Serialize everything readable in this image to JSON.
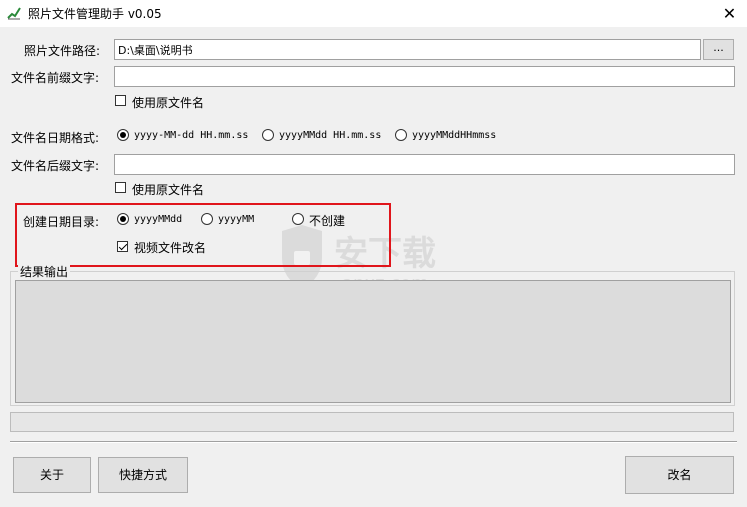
{
  "window": {
    "title": "照片文件管理助手 v0.05",
    "close_glyph": "✕"
  },
  "form": {
    "photo_path_label": "照片文件路径:",
    "photo_path_value": "D:\\桌面\\说明书",
    "browse_label": "...",
    "prefix_label": "文件名前缀文字:",
    "prefix_value": "",
    "use_original_name_1": "使用原文件名",
    "date_format_label": "文件名日期格式:",
    "date_formats": [
      "yyyy-MM-dd HH.mm.ss",
      "yyyyMMdd HH.mm.ss",
      "yyyyMMddHHmmss"
    ],
    "date_format_selected": 0,
    "suffix_label": "文件名后缀文字:",
    "suffix_value": "",
    "use_original_name_2": "使用原文件名",
    "create_dir_label": "创建日期目录:",
    "create_dir_options": [
      "yyyyMMdd",
      "yyyyMM",
      "不创建"
    ],
    "create_dir_selected": 0,
    "video_rename_label": "视频文件改名",
    "video_rename_checked": true,
    "output_group_label": "结果输出"
  },
  "buttons": {
    "about": "关于",
    "shortcut": "快捷方式",
    "rename": "改名"
  },
  "watermark": {
    "text_cn": "安下载",
    "text_en": "anxz.com"
  },
  "colors": {
    "highlight_box": "#e0151b",
    "client_bg": "#f0f0f0"
  }
}
